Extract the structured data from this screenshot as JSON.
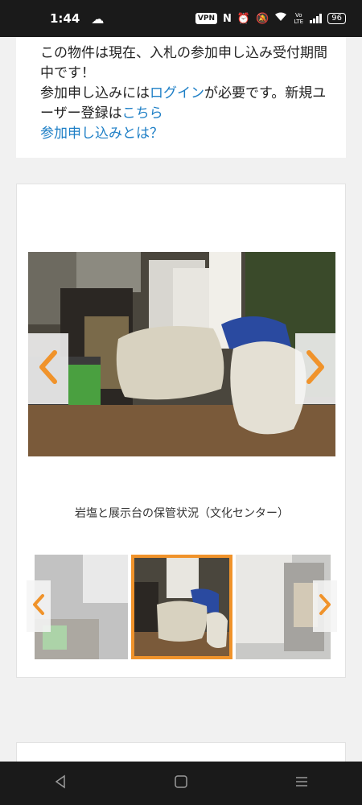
{
  "status_bar": {
    "time": "1:44",
    "vpn": "VPN",
    "nfc": "N",
    "volte": "Vo LTE",
    "battery": "96",
    "icons": [
      "cloud-app-icon",
      "vpn-icon",
      "nfc-icon",
      "alarm-icon",
      "mute-icon",
      "wifi-icon",
      "volte-icon",
      "signal-icon",
      "battery-icon"
    ]
  },
  "notice": {
    "line1": "この物件は現在、入札の参加申し込み受付期間中です！",
    "line2_prefix": "参加申し込みには",
    "login_link": "ログイン",
    "line2_mid": "が必要です。新規ユーザー登録は",
    "register_link": "こちら",
    "about_link": "参加申し込みとは？"
  },
  "gallery": {
    "caption": "岩塩と展示台の保管状況（文化センター）",
    "prev_icon": "chevron-left-icon",
    "next_icon": "chevron-right-icon",
    "thumb_count": 3,
    "active_thumb": 2
  },
  "colors": {
    "accent": "#f0932b",
    "link": "#1e7fc6"
  }
}
